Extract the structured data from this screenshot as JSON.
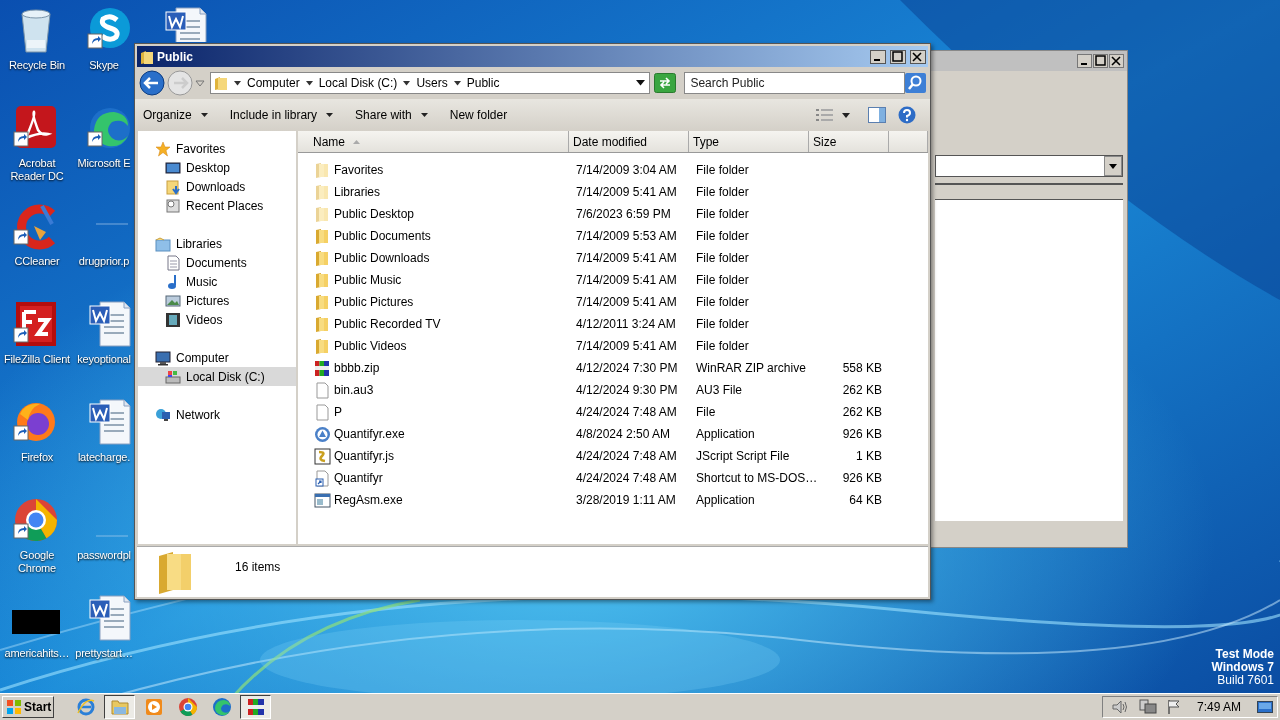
{
  "desktop": {
    "icons": [
      {
        "label": "Recycle Bin",
        "shortcut": false
      },
      {
        "label": "Acrobat Reader DC",
        "shortcut": true
      },
      {
        "label": "CCleaner",
        "shortcut": true
      },
      {
        "label": "FileZilla Client",
        "shortcut": true
      },
      {
        "label": "Firefox",
        "shortcut": true
      },
      {
        "label": "Google Chrome",
        "shortcut": true
      },
      {
        "label": "americahits…",
        "shortcut": false
      },
      {
        "label": "Skype",
        "shortcut": true
      },
      {
        "label": "Microsoft E",
        "shortcut": true
      },
      {
        "label": "drugprior.p",
        "shortcut": false
      },
      {
        "label": "keyoptional",
        "shortcut": false
      },
      {
        "label": "latecharge.",
        "shortcut": false
      },
      {
        "label": "passwordpl",
        "shortcut": false
      },
      {
        "label": "prettystart…",
        "shortcut": false
      },
      {
        "shortcut": false
      }
    ],
    "os_notice": [
      "Test Mode",
      "Windows 7",
      "Build 7601"
    ]
  },
  "window": {
    "title": "Public",
    "address": {
      "segments": [
        "Computer",
        "Local Disk (C:)",
        "Users",
        "Public"
      ]
    },
    "search": {
      "placeholder": "Search Public"
    },
    "toolbar": [
      {
        "label": "Organize",
        "dropdown": true
      },
      {
        "label": "Include in library",
        "dropdown": true
      },
      {
        "label": "Share with",
        "dropdown": true
      },
      {
        "label": "New folder",
        "dropdown": false
      }
    ],
    "navigation": [
      {
        "label": "Favorites",
        "selected": false,
        "children": [
          {
            "label": "Desktop",
            "selected": false
          },
          {
            "label": "Downloads",
            "selected": false
          },
          {
            "label": "Recent Places",
            "selected": false
          }
        ]
      },
      {
        "label": "Libraries",
        "selected": false,
        "children": [
          {
            "label": "Documents",
            "selected": false
          },
          {
            "label": "Music",
            "selected": false
          },
          {
            "label": "Pictures",
            "selected": false
          },
          {
            "label": "Videos",
            "selected": false
          }
        ]
      },
      {
        "label": "Computer",
        "selected": false,
        "children": [
          {
            "label": "Local Disk (C:)",
            "selected": true
          }
        ]
      },
      {
        "label": "Network",
        "selected": false
      }
    ],
    "table": {
      "columns": [
        {
          "label": "Name",
          "sorted": true
        },
        {
          "label": "Date modified",
          "sorted": false
        },
        {
          "label": "Type",
          "sorted": false
        },
        {
          "label": "Size",
          "sorted": false
        }
      ],
      "rows": [
        {
          "kind": "folder",
          "hidden": true,
          "name": "Favorites",
          "date": "7/14/2009 3:04 AM",
          "type": "File folder"
        },
        {
          "kind": "folder",
          "hidden": true,
          "name": "Libraries",
          "date": "7/14/2009 5:41 AM",
          "type": "File folder"
        },
        {
          "kind": "folder",
          "hidden": true,
          "name": "Public Desktop",
          "date": "7/6/2023 6:59 PM",
          "type": "File folder"
        },
        {
          "kind": "folder",
          "hidden": false,
          "name": "Public Documents",
          "date": "7/14/2009 5:53 AM",
          "type": "File folder"
        },
        {
          "kind": "folder",
          "hidden": false,
          "name": "Public Downloads",
          "date": "7/14/2009 5:41 AM",
          "type": "File folder"
        },
        {
          "kind": "folder",
          "hidden": false,
          "name": "Public Music",
          "date": "7/14/2009 5:41 AM",
          "type": "File folder"
        },
        {
          "kind": "folder",
          "hidden": false,
          "name": "Public Pictures",
          "date": "7/14/2009 5:41 AM",
          "type": "File folder"
        },
        {
          "kind": "folder",
          "hidden": false,
          "name": "Public Recorded TV",
          "date": "4/12/2011 3:24 AM",
          "type": "File folder"
        },
        {
          "kind": "folder",
          "hidden": false,
          "name": "Public Videos",
          "date": "7/14/2009 5:41 AM",
          "type": "File folder"
        },
        {
          "kind": "archive",
          "hidden": false,
          "name": "bbbb.zip",
          "date": "4/12/2024 7:30 PM",
          "type": "WinRAR ZIP archive",
          "size": "558 KB"
        },
        {
          "kind": "file",
          "hidden": false,
          "name": "bin.au3",
          "date": "4/12/2024 9:30 PM",
          "type": "AU3 File",
          "size": "262 KB"
        },
        {
          "kind": "file",
          "hidden": false,
          "name": "P",
          "date": "4/24/2024 7:48 AM",
          "type": "File",
          "size": "262 KB"
        },
        {
          "kind": "app",
          "hidden": false,
          "name": "Quantifyr.exe",
          "date": "4/8/2024 2:50 AM",
          "type": "Application",
          "size": "926 KB"
        },
        {
          "kind": "script",
          "hidden": false,
          "name": "Quantifyr.js",
          "date": "4/24/2024 7:48 AM",
          "type": "JScript Script File",
          "size": "1 KB"
        },
        {
          "kind": "shortcut",
          "hidden": false,
          "name": "Quantifyr",
          "date": "4/24/2024 7:48 AM",
          "type": "Shortcut to MS-DOS…",
          "size": "926 KB"
        },
        {
          "kind": "program",
          "hidden": false,
          "name": "RegAsm.exe",
          "date": "3/28/2019 1:11 AM",
          "type": "Application",
          "size": "64 KB"
        }
      ]
    },
    "details": {
      "count": "16 items"
    }
  },
  "taskbar": {
    "start": "Start",
    "apps": [
      {
        "active": false
      },
      {
        "active": true
      },
      {
        "active": false
      },
      {
        "active": false
      },
      {
        "active": false
      },
      {
        "active": true
      }
    ],
    "clock": "7:49 AM"
  }
}
